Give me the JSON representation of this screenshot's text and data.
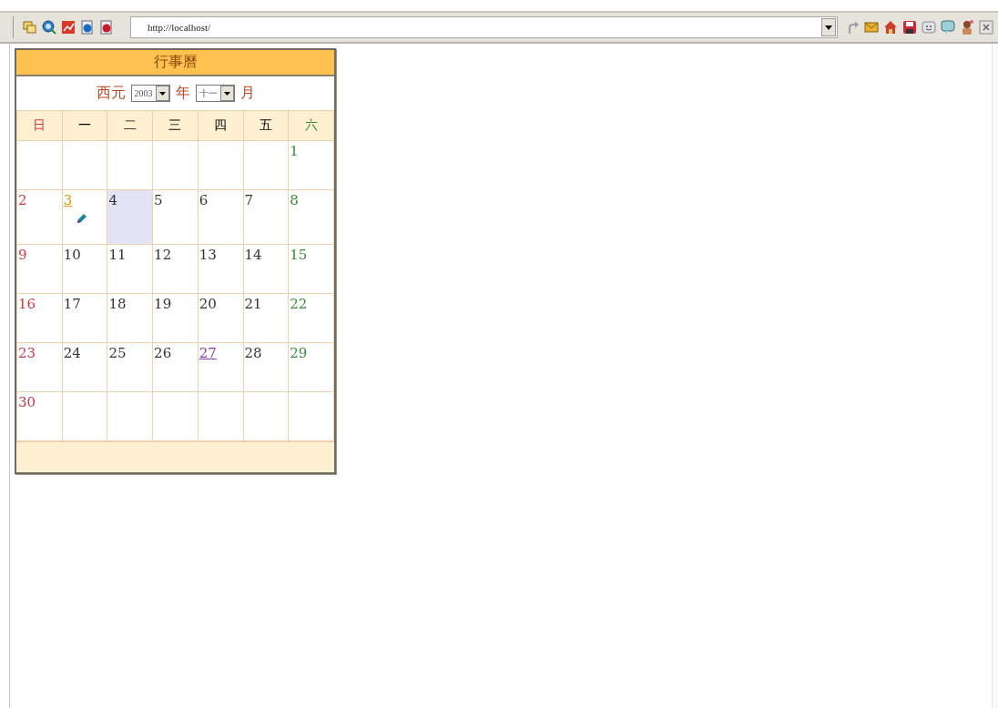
{
  "toolbar": {
    "address": "http://localhost/"
  },
  "calendar": {
    "title": "行事曆",
    "era_label": "西元",
    "year": "2003",
    "year_label": "年",
    "month": "十一",
    "month_label": "月",
    "weekdays": [
      "日",
      "一",
      "二",
      "三",
      "四",
      "五",
      "六"
    ],
    "weeks": [
      {
        "cells": [
          {
            "kind": "blank"
          },
          {
            "kind": "blank"
          },
          {
            "kind": "blank"
          },
          {
            "kind": "blank"
          },
          {
            "kind": "blank"
          },
          {
            "kind": "blank"
          },
          {
            "kind": "day",
            "label": "1",
            "selected": false,
            "note": false
          }
        ]
      },
      {
        "cells": [
          {
            "kind": "day",
            "label": "2",
            "selected": false,
            "note": false
          },
          {
            "kind": "link",
            "label": "3",
            "selected": false,
            "note": true
          },
          {
            "kind": "day",
            "label": "4",
            "selected": true,
            "note": false
          },
          {
            "kind": "day",
            "label": "5",
            "selected": false,
            "note": false
          },
          {
            "kind": "day",
            "label": "6",
            "selected": false,
            "note": false
          },
          {
            "kind": "day",
            "label": "7",
            "selected": false,
            "note": false
          },
          {
            "kind": "day",
            "label": "8",
            "selected": false,
            "note": false
          }
        ]
      },
      {
        "cells": [
          {
            "kind": "day",
            "label": "9",
            "selected": false,
            "note": false
          },
          {
            "kind": "day",
            "label": "10",
            "selected": false,
            "note": false
          },
          {
            "kind": "day",
            "label": "11",
            "selected": false,
            "note": false
          },
          {
            "kind": "day",
            "label": "12",
            "selected": false,
            "note": false
          },
          {
            "kind": "day",
            "label": "13",
            "selected": false,
            "note": false
          },
          {
            "kind": "day",
            "label": "14",
            "selected": false,
            "note": false
          },
          {
            "kind": "day",
            "label": "15",
            "selected": false,
            "note": false
          }
        ]
      },
      {
        "cells": [
          {
            "kind": "day",
            "label": "16",
            "selected": false,
            "note": false
          },
          {
            "kind": "day",
            "label": "17",
            "selected": false,
            "note": false
          },
          {
            "kind": "day",
            "label": "18",
            "selected": false,
            "note": false
          },
          {
            "kind": "day",
            "label": "19",
            "selected": false,
            "note": false
          },
          {
            "kind": "day",
            "label": "20",
            "selected": false,
            "note": false
          },
          {
            "kind": "day",
            "label": "21",
            "selected": false,
            "note": false
          },
          {
            "kind": "day",
            "label": "22",
            "selected": false,
            "note": false
          }
        ]
      },
      {
        "cells": [
          {
            "kind": "day",
            "label": "23",
            "selected": false,
            "note": false
          },
          {
            "kind": "day",
            "label": "24",
            "selected": false,
            "note": false
          },
          {
            "kind": "day",
            "label": "25",
            "selected": false,
            "note": false
          },
          {
            "kind": "day",
            "label": "26",
            "selected": false,
            "note": false
          },
          {
            "kind": "visited-link",
            "label": "27",
            "selected": false,
            "note": false
          },
          {
            "kind": "day",
            "label": "28",
            "selected": false,
            "note": false
          },
          {
            "kind": "day",
            "label": "29",
            "selected": false,
            "note": false
          }
        ]
      },
      {
        "cells": [
          {
            "kind": "day",
            "label": "30",
            "selected": false,
            "note": false
          },
          {
            "kind": "blank"
          },
          {
            "kind": "blank"
          },
          {
            "kind": "blank"
          },
          {
            "kind": "blank"
          },
          {
            "kind": "blank"
          },
          {
            "kind": "blank"
          }
        ]
      }
    ]
  }
}
